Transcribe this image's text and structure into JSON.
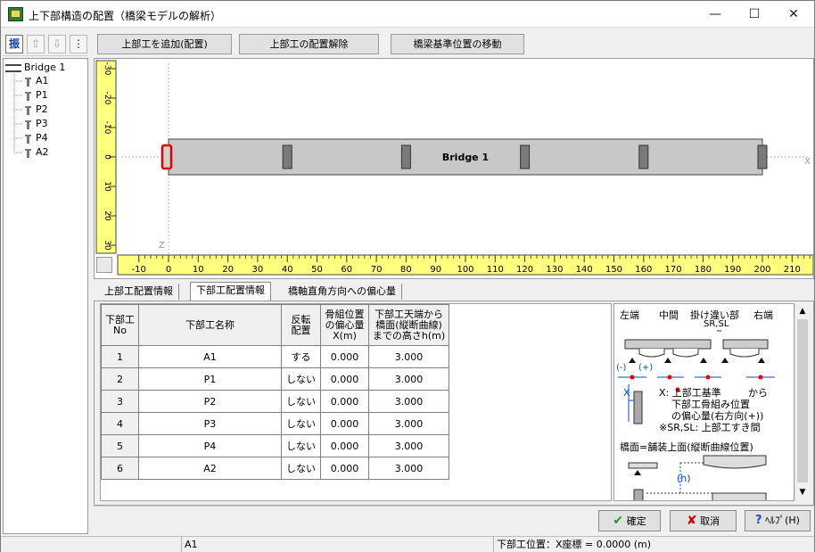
{
  "window": {
    "title": "上下部構造の配置（橋梁モデルの解析）",
    "minimize_icon": "minimize-icon",
    "maximize_icon": "maximize-icon",
    "close_icon": "close-icon"
  },
  "left_toolbar": {
    "toggle_label": "振",
    "up_icon": "arrow-up-icon",
    "down_icon": "arrow-down-icon",
    "more_icon": "dots-icon"
  },
  "tree": {
    "root": "Bridge 1",
    "items": [
      "A1",
      "P1",
      "P2",
      "P3",
      "P4",
      "A2"
    ]
  },
  "top_buttons": {
    "add": "上部工を追加(配置)",
    "remove": "上部工の配置解除",
    "move": "橋梁基準位置の移動"
  },
  "canvas": {
    "bridge_label": "Bridge 1",
    "x_axis_label": "X",
    "z_axis_label": "Z",
    "x_ticks": [
      "-10",
      "0",
      "10",
      "20",
      "30",
      "40",
      "50",
      "60",
      "70",
      "80",
      "90",
      "100",
      "110",
      "120",
      "130",
      "140",
      "150",
      "160",
      "170",
      "180",
      "190",
      "200",
      "210"
    ],
    "y_ticks": [
      "-30",
      "-20",
      "-10",
      "0",
      "10",
      "20",
      "30"
    ],
    "girder_start": 0,
    "girder_end": 200,
    "pier_positions": [
      0,
      40,
      80,
      120,
      160,
      200
    ],
    "selected_support": "A1"
  },
  "tabs": [
    "上部工配置情報",
    "下部工配置情報",
    "橋軸直角方向への偏心量"
  ],
  "table": {
    "headers": {
      "no": "下部工\nNo",
      "name": "下部工名称",
      "reverse": "反転\n配置",
      "offset": "骨組位置\nの偏心量\nX(m)",
      "height": "下部工天端から\n橋面(縦断曲線)\nまでの高さh(m)"
    },
    "rows": [
      {
        "no": "1",
        "name": "A1",
        "reverse": "する",
        "offset": "0.000",
        "height": "3.000"
      },
      {
        "no": "2",
        "name": "P1",
        "reverse": "しない",
        "offset": "0.000",
        "height": "3.000"
      },
      {
        "no": "3",
        "name": "P2",
        "reverse": "しない",
        "offset": "0.000",
        "height": "3.000"
      },
      {
        "no": "4",
        "name": "P3",
        "reverse": "しない",
        "offset": "0.000",
        "height": "3.000"
      },
      {
        "no": "5",
        "name": "P4",
        "reverse": "しない",
        "offset": "0.000",
        "height": "3.000"
      },
      {
        "no": "6",
        "name": "A2",
        "reverse": "しない",
        "offset": "0.000",
        "height": "3.000"
      }
    ]
  },
  "diagram": {
    "left_end": "左端",
    "middle": "中間",
    "staggered": "掛け違い部",
    "right_end": "右端",
    "sr_sl": "SR,SL",
    "minus": "(-)",
    "plus": "(+)",
    "x_mark": "X",
    "note1": "X: 上部工基準",
    "note1b": "から",
    "note2": "下部工骨組み位置",
    "note3": "の偏心量(右方向(+))",
    "note4": "※SR,SL: 上部工すき間",
    "deck_note": "橋面=舗装上面(縦断曲線位置)",
    "h_mark": "(h)"
  },
  "bottom_buttons": {
    "ok": "確定",
    "cancel": "取消",
    "help": "ﾍﾙﾌﾟ(H)"
  },
  "status": {
    "selection": "A1",
    "coordinate": "下部工位置：X座標 = 0.0000 (m)"
  },
  "colors": {
    "ruler": "#ffff80",
    "girder": "#c8c8c8",
    "selection": "#e00000",
    "support": "#7a7a7a"
  }
}
